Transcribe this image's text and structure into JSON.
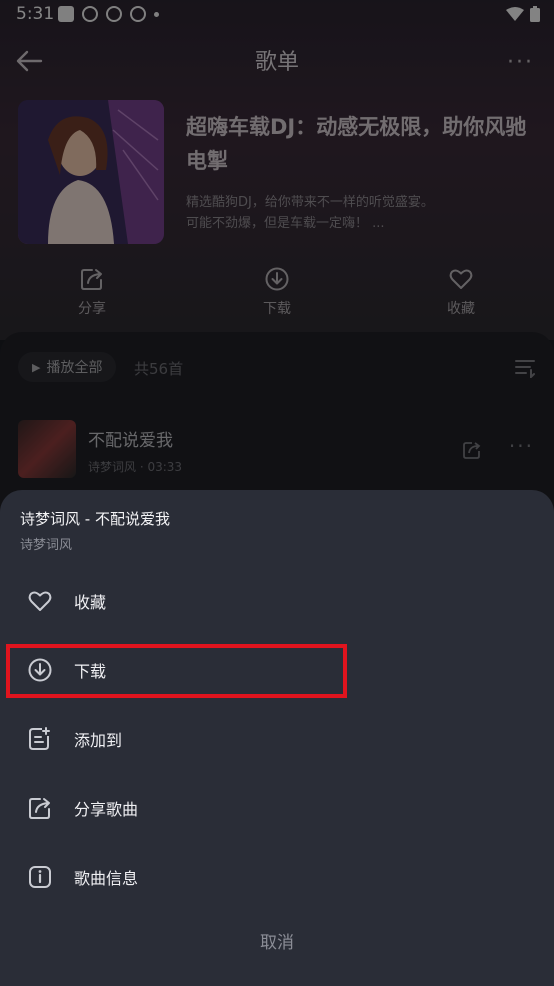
{
  "status": {
    "time": "5:31"
  },
  "header": {
    "title": "歌单"
  },
  "playlist": {
    "title": "超嗨车载DJ：动感无极限，助你风驰电掣",
    "desc_line1": "精选酷狗DJ，给你带来不一样的听觉盛宴。",
    "desc_line2": "可能不劲爆，但是车载一定嗨！ ..."
  },
  "actions": [
    {
      "label": "分享",
      "icon": "share-icon"
    },
    {
      "label": "下载",
      "icon": "download-icon"
    },
    {
      "label": "收藏",
      "icon": "heart-icon"
    }
  ],
  "list": {
    "play_all": "播放全部",
    "count": "共56首"
  },
  "song": {
    "name": "不配说爱我",
    "artist": "诗梦词风",
    "duration": "03:33"
  },
  "sheet": {
    "title": "诗梦词风 - 不配说爱我",
    "subtitle": "诗梦词风",
    "items": [
      {
        "label": "收藏",
        "icon": "heart-icon"
      },
      {
        "label": "下载",
        "icon": "download-icon"
      },
      {
        "label": "添加到",
        "icon": "add-to-list-icon"
      },
      {
        "label": "分享歌曲",
        "icon": "share-icon"
      },
      {
        "label": "歌曲信息",
        "icon": "info-icon"
      }
    ],
    "cancel": "取消"
  },
  "colors": {
    "highlight": "#e0141e",
    "sheet_bg": "#2a2d37"
  }
}
